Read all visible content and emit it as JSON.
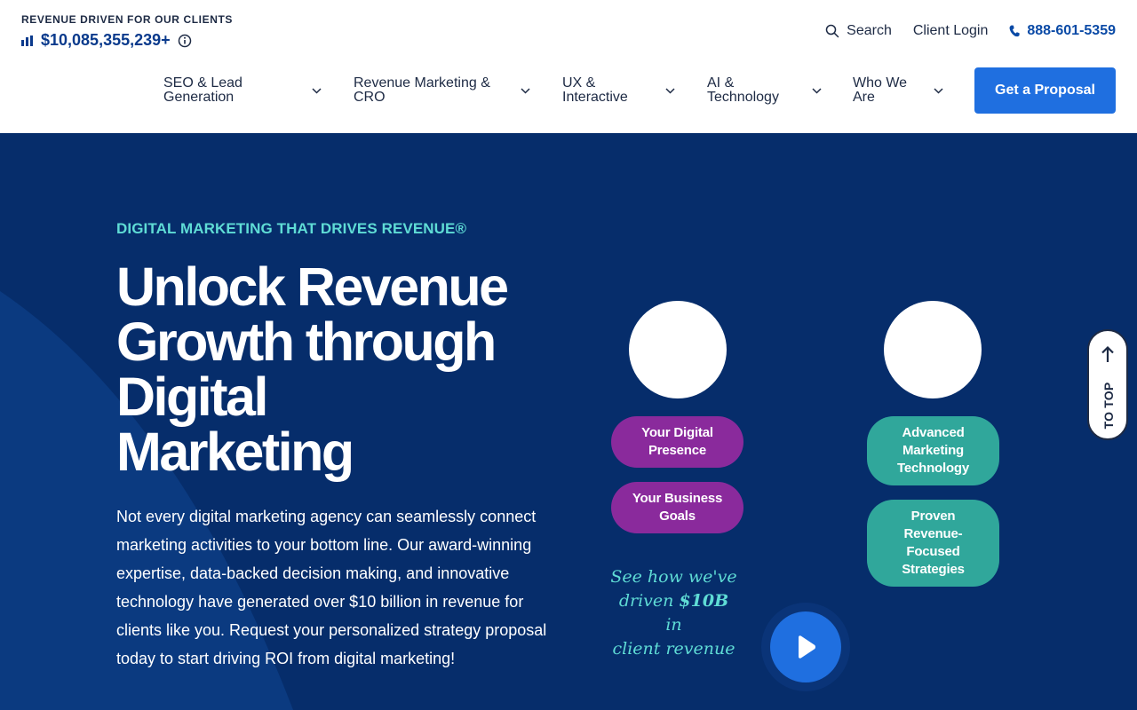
{
  "header": {
    "revenue_label": "REVENUE DRIVEN FOR OUR CLIENTS",
    "revenue_value": "$10,085,355,239+",
    "search_label": "Search",
    "client_login_label": "Client Login",
    "phone": "888-601-5359",
    "nav": [
      {
        "line1": "SEO & Lead",
        "line2": "Generation"
      },
      {
        "line1": "Revenue Marketing &",
        "line2": "CRO"
      },
      {
        "line1": "UX &",
        "line2": "Interactive"
      },
      {
        "line1": "AI &",
        "line2": "Technology"
      },
      {
        "line1": "Who We",
        "line2": "Are"
      }
    ],
    "proposal_button": "Get a Proposal",
    "accent_color": "#1f6fe0"
  },
  "hero": {
    "eyebrow": "DIGITAL MARKETING THAT DRIVES REVENUE®",
    "headline_lines": [
      "Unlock Revenue",
      "Growth through",
      "Digital",
      "Marketing"
    ],
    "body": "Not every digital marketing agency can seamlessly connect marketing activities to your bottom line. Our award-winning expertise, data-backed decision making, and innovative technology have generated over $10 billion in revenue for clients like you. Request your personalized strategy proposal today to start driving ROI from digital marketing!",
    "background_color": "#062d6b",
    "pills": {
      "digital_presence": "Your Digital Presence",
      "business_goals": "Your Business Goals",
      "advanced_tech": "Advanced Marketing Technology",
      "proven_strategies": "Proven Revenue-Focused Strategies"
    },
    "video_prompt": {
      "line1": "See how we've",
      "line2_prefix": "driven ",
      "line2_emphasis": "$10B",
      "line2_suffix": " in",
      "line3": "client revenue"
    }
  },
  "to_top_label": "TO TOP",
  "icons": {
    "bars": "bar-chart-icon",
    "info": "info-icon",
    "search": "search-icon",
    "phone": "phone-icon",
    "chevron": "chevron-down-icon",
    "play": "play-icon",
    "arrow_up": "arrow-up-icon"
  }
}
